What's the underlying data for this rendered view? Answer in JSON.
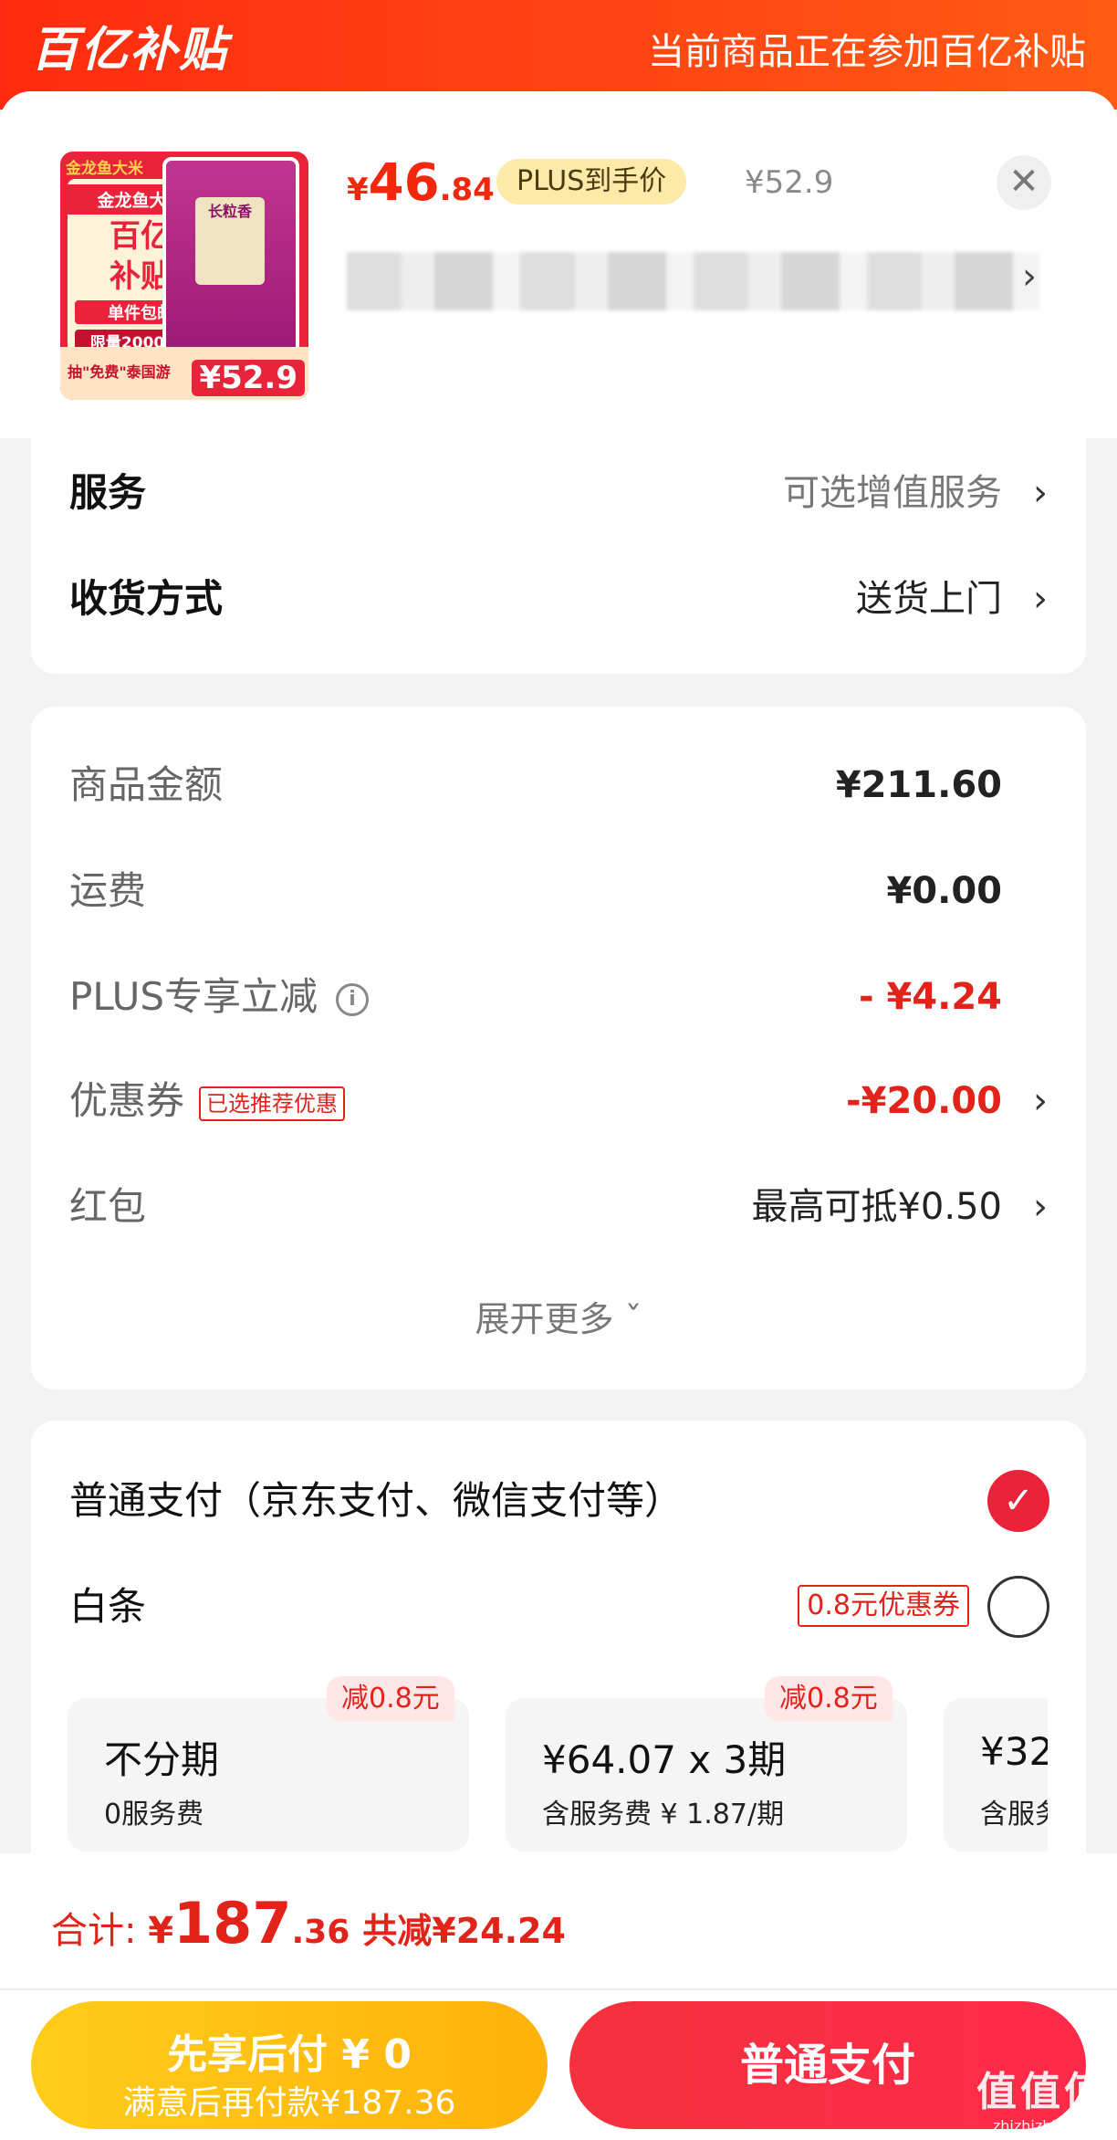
{
  "header": {
    "brand": "百亿补贴",
    "note": "当前商品正在参加百亿补贴"
  },
  "product": {
    "thumb": {
      "brand": "金龙鱼大米",
      "tag_line1": "金龙鱼大米",
      "tag_line2a": "百亿",
      "tag_line2b": "补贴",
      "tag_line3": "单件包邮",
      "tag_line4": "限量20000件",
      "bag_label": "长粒香",
      "promo": "抽\"免费\"泰国游",
      "price": "¥52.9"
    },
    "price_symbol": "¥",
    "price_int": "46",
    "price_dec": ".84",
    "plus_label": "PLUS到手价",
    "original_price": "¥52.9",
    "close_symbol": "✕",
    "name_chevron": "›"
  },
  "service": {
    "service_label": "服务",
    "service_value": "可选增值服务",
    "delivery_label": "收货方式",
    "delivery_value": "送货上门",
    "chevron": "›"
  },
  "amounts": {
    "goods_label": "商品金额",
    "goods_value": "¥211.60",
    "shipping_label": "运费",
    "shipping_value": "¥0.00",
    "plus_label": "PLUS专享立减",
    "plus_info": "i",
    "plus_value": "- ¥4.24",
    "coupon_label": "优惠券",
    "coupon_tag": "已选推荐优惠",
    "coupon_value": "-¥20.00",
    "redpacket_label": "红包",
    "redpacket_value": "最高可抵¥0.50",
    "expand_label": "展开更多 ˇ"
  },
  "payment": {
    "normal_label": "普通支付（京东支付、微信支付等）",
    "normal_check": "✓",
    "baitiao_label": "白条",
    "baitiao_coupon": "0.8元优惠券",
    "plans": [
      {
        "title": "不分期",
        "sub": "0服务费",
        "off": "减0.8元"
      },
      {
        "title": "¥64.07 x 3期",
        "sub": "含服务费 ¥ 1.87/期",
        "off": "减0.8元"
      },
      {
        "title": "¥32",
        "sub": "含服务",
        "off": ""
      }
    ]
  },
  "footer": {
    "total_label": "合计: ",
    "total_yen": "¥",
    "total_int": "187",
    "total_dec": ".36",
    "total_save": "共减¥24.24",
    "later_title": "先享后付 ¥ 0",
    "later_sub": "满意后再付款¥187.36",
    "pay_label": "普通支付"
  },
  "watermark": {
    "main": "值值值",
    "sub": "zhizhizhi.com"
  },
  "colors": {
    "brand_red": "#f2270c",
    "header_gradient_start": "#ff2b10",
    "later_button": "#ffb20a",
    "pay_button": "#f5313d"
  }
}
